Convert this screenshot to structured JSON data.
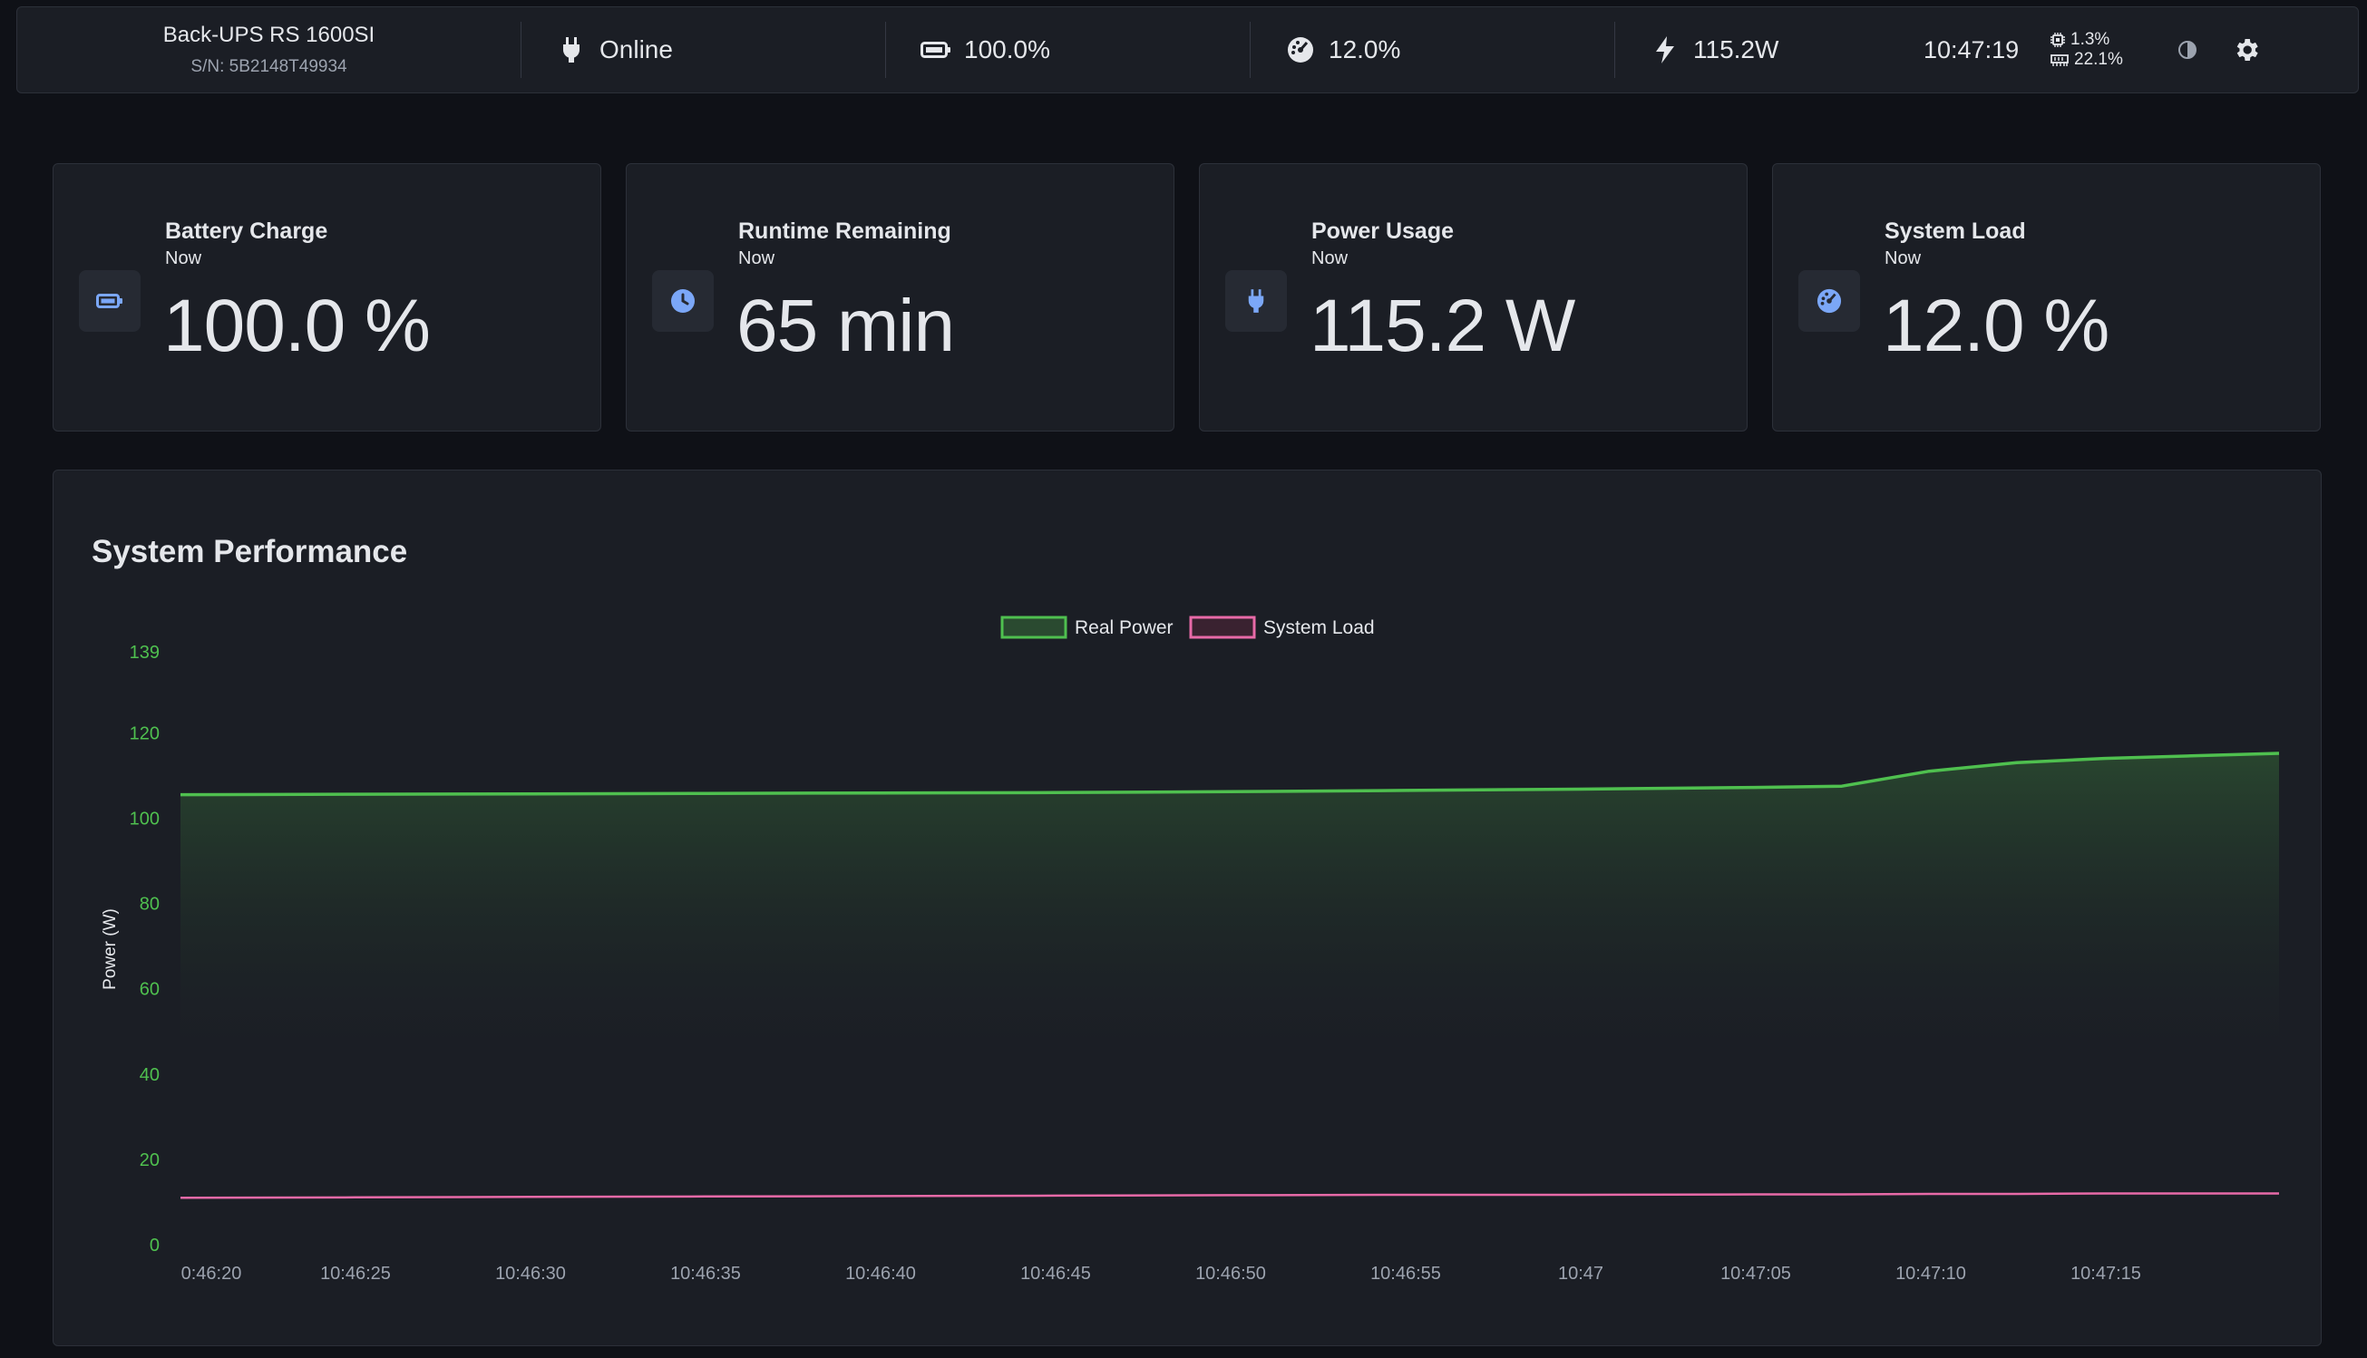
{
  "topbar": {
    "device_name": "Back-UPS RS 1600SI",
    "serial": "S/N: 5B2148T49934",
    "status": "Online",
    "battery": "100.0%",
    "load": "12.0%",
    "power": "115.2W",
    "time": "10:47:19",
    "cpu": "1.3%",
    "memory": "22.1%"
  },
  "cards": [
    {
      "title": "Battery Charge",
      "subtitle": "Now",
      "value": "100.0 %",
      "icon": "battery-icon"
    },
    {
      "title": "Runtime Remaining",
      "subtitle": "Now",
      "value": "65 min",
      "icon": "clock-icon"
    },
    {
      "title": "Power Usage",
      "subtitle": "Now",
      "value": "115.2 W",
      "icon": "plug-icon"
    },
    {
      "title": "System Load",
      "subtitle": "Now",
      "value": "12.0 %",
      "icon": "gauge-icon"
    }
  ],
  "colors": {
    "accent_icon": "#7ba7f7",
    "real_power": "#4fc04f",
    "system_load": "#e86aa8",
    "tick_green": "#4fc04f"
  },
  "chart_panel": {
    "title": "System Performance"
  },
  "chart_data": {
    "type": "area",
    "title": "System Performance",
    "ylabel": "Power (W)",
    "xlabel": "",
    "ylim": [
      0,
      139
    ],
    "yticks": [
      "0",
      "20",
      "40",
      "60",
      "80",
      "100",
      "120",
      "139"
    ],
    "categories": [
      "0:46:20",
      "10:46:25",
      "10:46:30",
      "10:46:35",
      "10:46:40",
      "10:46:45",
      "10:46:50",
      "10:46:55",
      "10:47",
      "10:47:05",
      "10:47:10",
      "10:47:15"
    ],
    "legend_position": "top-center",
    "grid": false,
    "x": [
      0,
      1,
      2,
      3,
      4,
      5,
      6,
      7,
      8,
      9,
      9.5,
      10,
      10.5,
      11,
      11.5,
      12
    ],
    "series": [
      {
        "name": "Real Power",
        "values": [
          105.5,
          105.6,
          105.7,
          105.8,
          105.9,
          106.0,
          106.2,
          106.5,
          106.8,
          107.2,
          107.5,
          111.0,
          113.0,
          114.0,
          114.6,
          115.2
        ]
      },
      {
        "name": "System Load",
        "values": [
          11.0,
          11.1,
          11.2,
          11.3,
          11.4,
          11.5,
          11.6,
          11.7,
          11.7,
          11.8,
          11.8,
          11.9,
          11.9,
          12.0,
          12.0,
          12.0
        ]
      }
    ]
  }
}
